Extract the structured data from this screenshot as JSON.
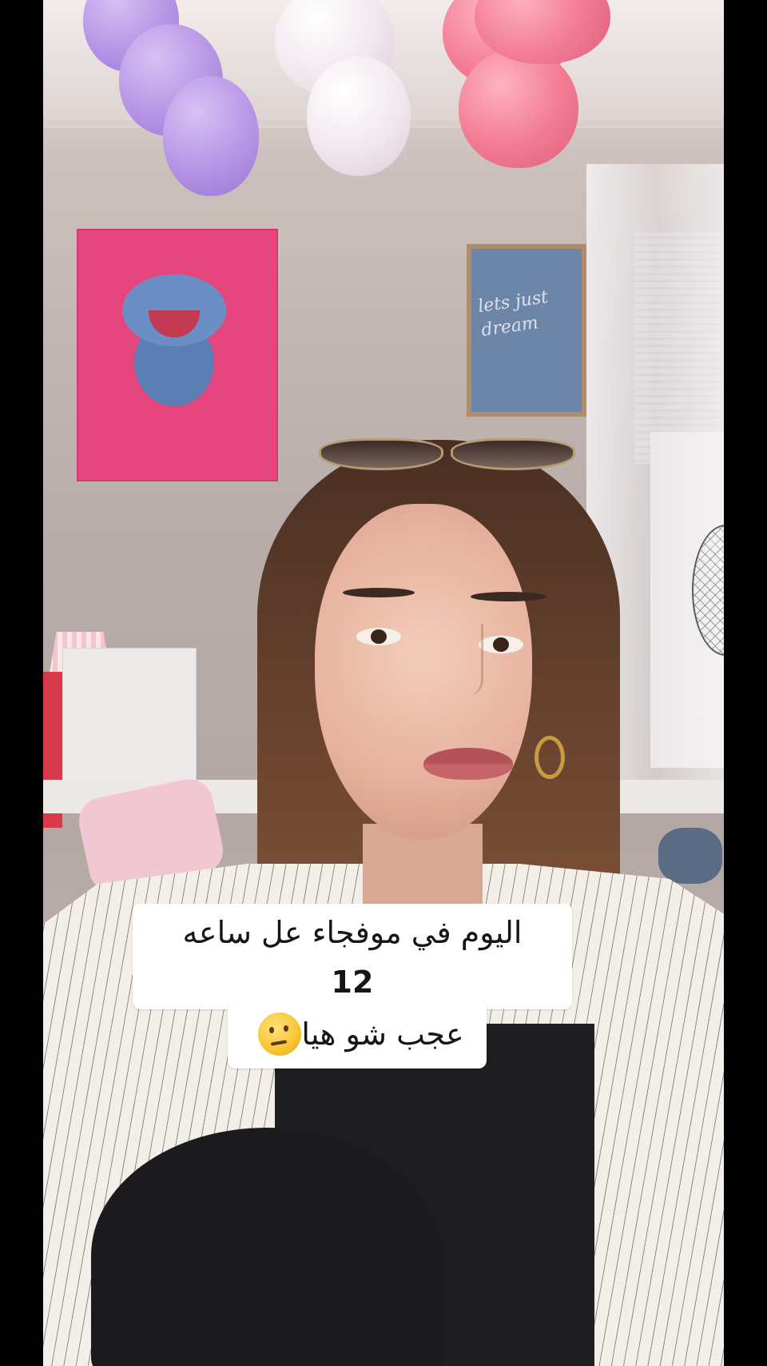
{
  "caption": {
    "line1": "اليوم في موفجاء عل ساعه",
    "number": "12",
    "line2": "عجب شو هيا",
    "emoji": "thinking-face"
  },
  "decor": {
    "poster_text": "lets just dream",
    "colors": {
      "balloon_purple": "#b694e6",
      "balloon_white": "#f1e7ee",
      "balloon_pink": "#f27b93",
      "poster_pink": "#e5467e",
      "frame_blue": "#6d86a8"
    }
  }
}
